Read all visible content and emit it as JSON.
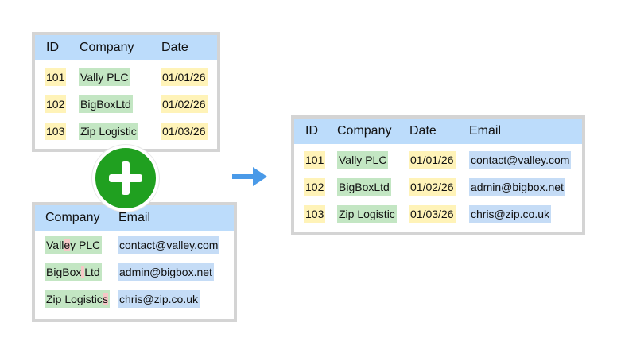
{
  "left_top_table": {
    "headers": [
      "ID",
      "Company",
      "Date"
    ],
    "rows": [
      [
        "101",
        "Vally PLC",
        "01/01/26"
      ],
      [
        "102",
        "BigBoxLtd",
        "01/02/26"
      ],
      [
        "103",
        "Zip Logistic",
        "01/03/26"
      ]
    ]
  },
  "left_bottom_table": {
    "headers": [
      "Company",
      "Email"
    ],
    "rows": [
      [
        [
          "Vall",
          "e",
          "y PLC"
        ],
        "contact@valley.com"
      ],
      [
        [
          "BigBox",
          " ",
          "Ltd"
        ],
        "admin@bigbox.net"
      ],
      [
        [
          "Zip Logistic",
          "s",
          ""
        ],
        "chris@zip.co.uk"
      ]
    ]
  },
  "result_table": {
    "headers": [
      "ID",
      "Company",
      "Date",
      "Email"
    ],
    "rows": [
      [
        "101",
        "Vally PLC",
        "01/01/26",
        "contact@valley.com"
      ],
      [
        "102",
        "BigBoxLtd",
        "01/02/26",
        "admin@bigbox.net"
      ],
      [
        "103",
        "Zip Logistic",
        "01/03/26",
        "chris@zip.co.uk"
      ]
    ]
  },
  "icons": {
    "merge": "plus-icon",
    "direction": "arrow-right-icon"
  },
  "colors": {
    "header": "#bcdcfb",
    "id_highlight": "#fff3b8",
    "company_highlight": "#c3e6c3",
    "email_highlight": "#c5dcf6",
    "difference_highlight": "#f6c6c6",
    "plus": "#20a020",
    "arrow": "#4a9ae8"
  }
}
